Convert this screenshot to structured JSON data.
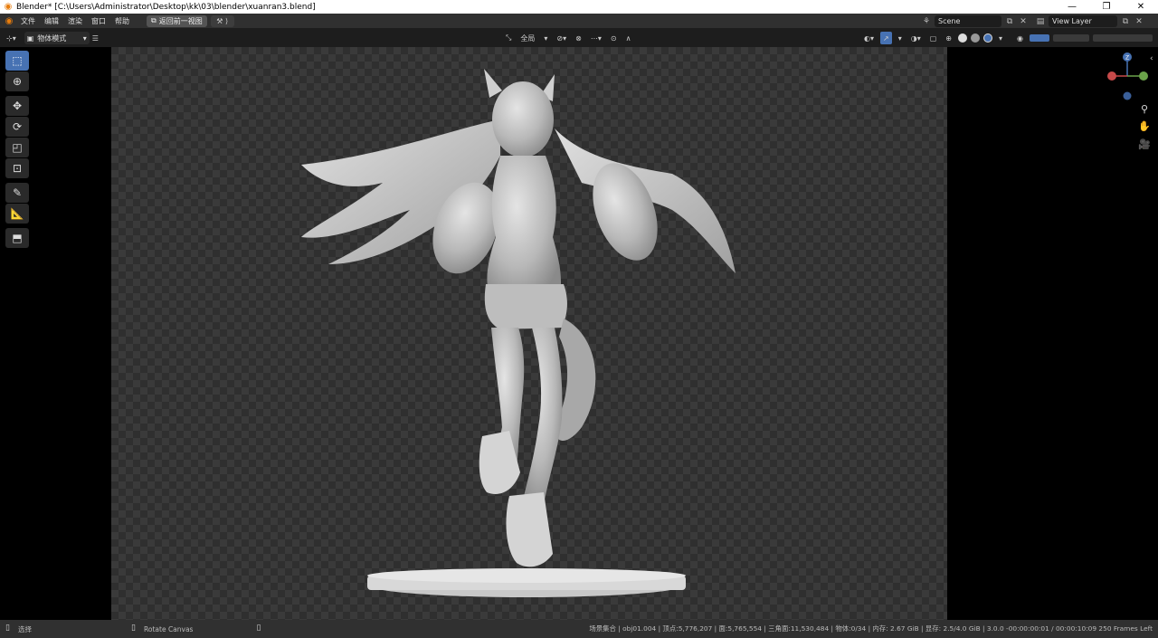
{
  "window": {
    "title": "Blender* [C:\\Users\\Administrator\\Desktop\\kk\\03\\blender\\xuanran3.blend]",
    "minimize": "—",
    "maximize": "❐",
    "close": "✕"
  },
  "menu": {
    "items": [
      "文件",
      "编辑",
      "渲染",
      "窗口",
      "帮助"
    ],
    "back_button": "返回前一视图",
    "scene_name": "Scene",
    "view_layer": "View Layer"
  },
  "viewport_header": {
    "mode": "物体模式",
    "transform_orientation": "全局"
  },
  "gizmo": {
    "x": "X",
    "y": "Y",
    "z": "Z"
  },
  "statusbar": {
    "left_action": "选择",
    "middle_action": "Rotate Canvas",
    "stats": "场景集合 | obj01.004 | 顶点:5,776,207 | 面:5,765,554 | 三角面:11,530,484 | 物体:0/34 | 内存: 2.67 GiB | 显存: 2.5/4.0 GiB | 3.0.0   -00:00:00:01 / 00:00:10:09  250 Frames Left"
  },
  "colors": {
    "accent": "#4772b3",
    "header": "#303030",
    "viewport_dark": "#2f2f2f"
  }
}
